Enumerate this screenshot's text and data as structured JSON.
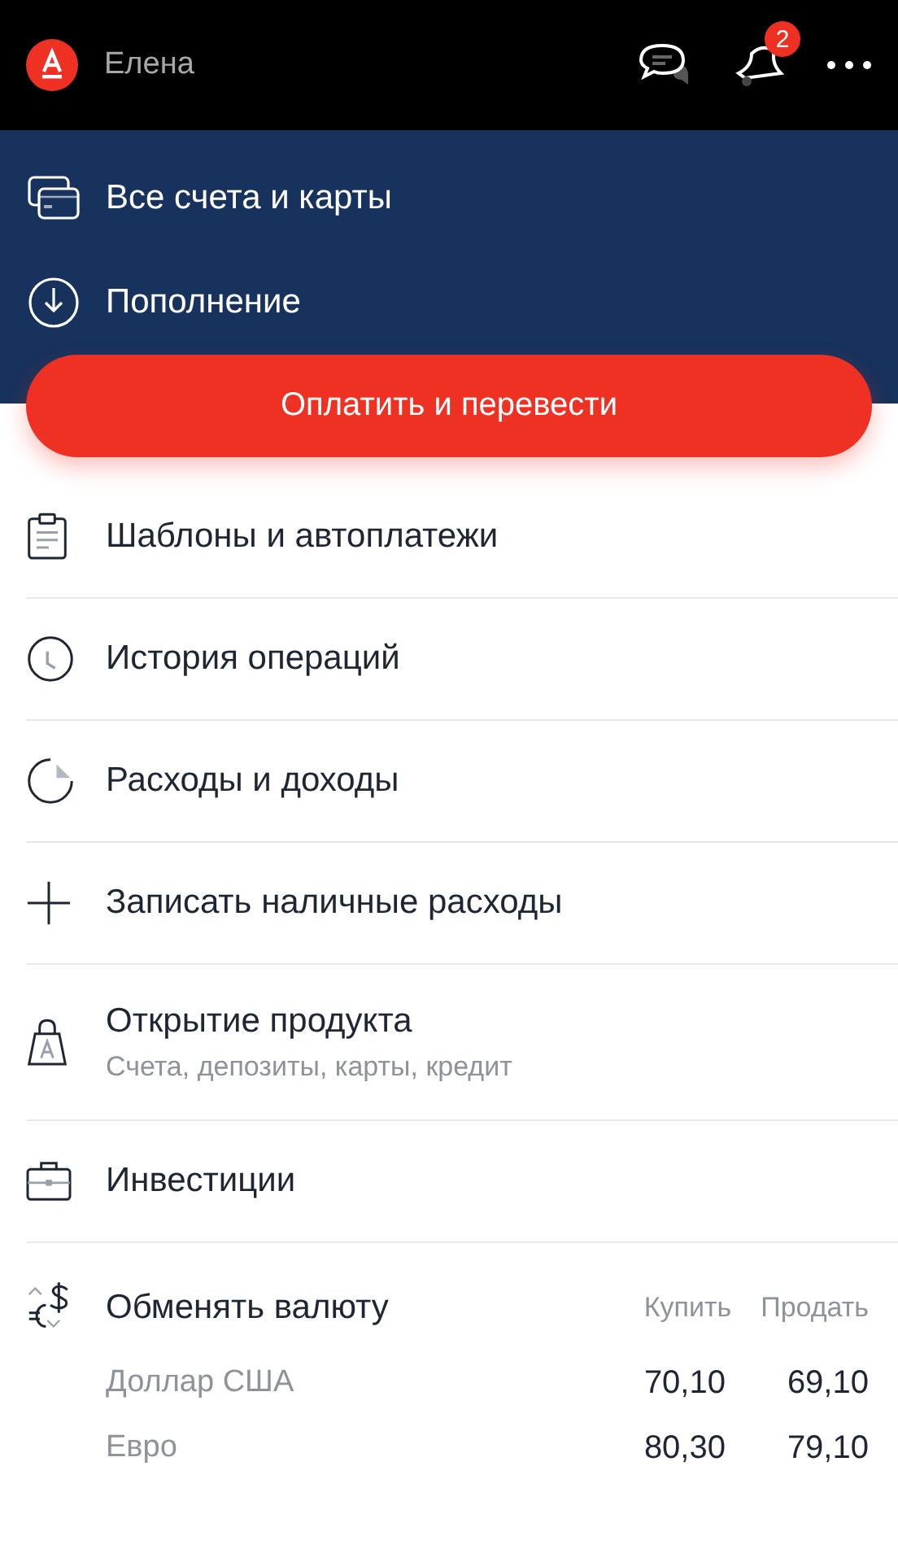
{
  "header": {
    "user_name": "Елена",
    "notification_count": "2"
  },
  "top_menu": [
    {
      "kind": "cards",
      "label": "Все счета и карты"
    },
    {
      "kind": "topup",
      "label": "Пополнение"
    }
  ],
  "pay_button": "Оплатить и перевести",
  "menu": [
    {
      "kind": "templates",
      "label": "Шаблоны и автоплатежи"
    },
    {
      "kind": "history",
      "label": "История операций"
    },
    {
      "kind": "expenses",
      "label": "Расходы и доходы"
    },
    {
      "kind": "add",
      "label": "Записать наличные расходы"
    },
    {
      "kind": "product",
      "label": "Открытие продукта",
      "subtitle": "Счета, депозиты, карты, кредит"
    },
    {
      "kind": "invest",
      "label": "Инвестиции"
    }
  ],
  "exchange": {
    "title": "Обменять валюту",
    "columns": [
      "Купить",
      "Продать"
    ],
    "rows": [
      {
        "currency": "Доллар США",
        "buy": "70,10",
        "sell": "69,10"
      },
      {
        "currency": "Евро",
        "buy": "80,30",
        "sell": "79,10"
      }
    ]
  }
}
